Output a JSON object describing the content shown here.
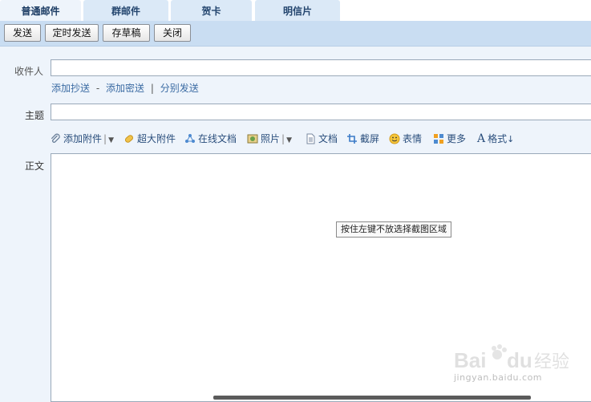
{
  "tabs": [
    {
      "label": "普通邮件"
    },
    {
      "label": "群邮件"
    },
    {
      "label": "贺卡"
    },
    {
      "label": "明信片"
    }
  ],
  "toolbar": {
    "send": "发送",
    "scheduled_send": "定时发送",
    "save_draft": "存草稿",
    "close": "关闭"
  },
  "form": {
    "recipient_label": "收件人",
    "recipient_value": "",
    "links": {
      "add_cc": "添加抄送",
      "dash": "-",
      "add_bcc": "添加密送",
      "pipe": "|",
      "separate_send": "分别发送"
    },
    "subject_label": "主题",
    "subject_value": "",
    "body_label": "正文"
  },
  "format_bar": {
    "attach": "添加附件",
    "big_attach": "超大附件",
    "online_doc": "在线文档",
    "photo": "照片",
    "doc": "文档",
    "screenshot": "截屏",
    "emoji": "表情",
    "more": "更多",
    "format": "格式"
  },
  "tooltip": "按住左键不放选择截图区域",
  "watermark": {
    "logo_text": "Baidu经验",
    "url": "jingyan.baidu.com"
  },
  "colors": {
    "toolbar_bg": "#c9ddf2",
    "page_bg": "#eef4fb",
    "link": "#3b6ba3"
  }
}
